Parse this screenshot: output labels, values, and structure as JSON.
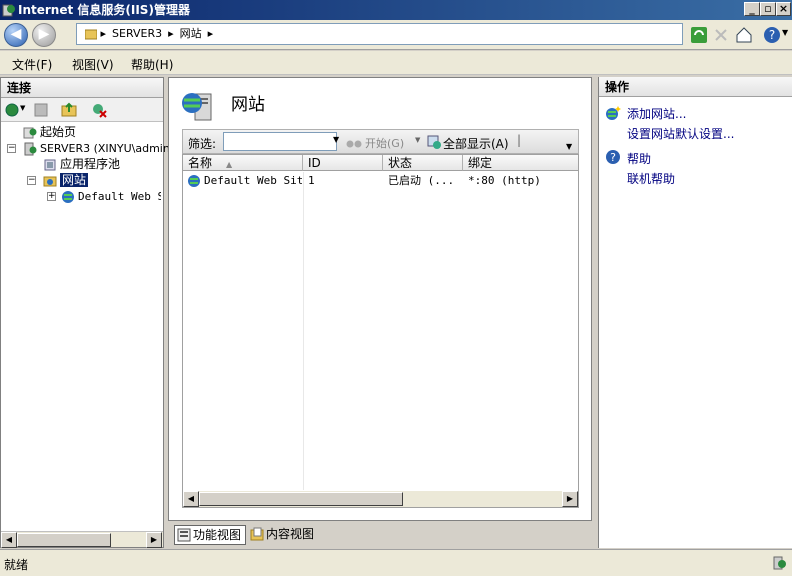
{
  "window": {
    "title": "Internet 信息服务(IIS)管理器"
  },
  "address": {
    "segments": [
      "SERVER3",
      "网站"
    ]
  },
  "menu": [
    "文件(F)",
    "视图(V)",
    "帮助(H)"
  ],
  "connections": {
    "title": "连接",
    "tree": {
      "start_page": "起始页",
      "server": "SERVER3 (XINYU\\admin",
      "app_pools": "应用程序池",
      "sites": "网站",
      "default_site": "Default Web S"
    }
  },
  "main": {
    "title": "网站",
    "filter_label": "筛选:",
    "start_label": "开始(G)",
    "show_all_label": "全部显示(A)",
    "columns": [
      "名称",
      "ID",
      "状态",
      "绑定"
    ],
    "rows": [
      {
        "name": "Default Web Site",
        "id": "1",
        "status": "已启动 (...",
        "binding": "*:80 (http)"
      }
    ],
    "tabs": {
      "features": "功能视图",
      "content": "内容视图"
    }
  },
  "actions": {
    "title": "操作",
    "add_site": "添加网站...",
    "set_defaults": "设置网站默认设置...",
    "help": "帮助",
    "online_help": "联机帮助"
  },
  "status": {
    "text": "就绪"
  }
}
